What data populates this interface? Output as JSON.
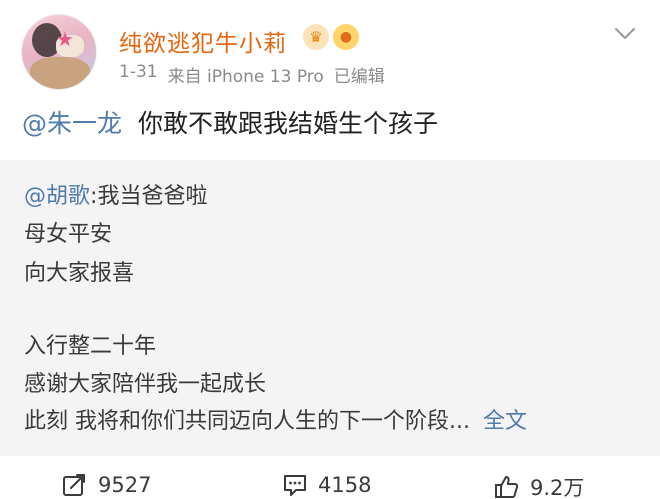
{
  "post": {
    "username": "纯欲逃犯牛小莉",
    "date": "1-31",
    "source": "来自 iPhone 13 Pro",
    "edited": "已编辑",
    "mention": "@朱一龙",
    "text": "你敢不敢跟我结婚生个孩子"
  },
  "repost": {
    "mention": "@胡歌",
    "lines": [
      "我当爸爸啦",
      "母女平安",
      "向大家报喜",
      "",
      "入行整二十年",
      "感谢大家陪伴我一起成长",
      "此刻 我将和你们共同迈向人生的下一个阶段..."
    ],
    "separator": ":",
    "full_text_link": "全文"
  },
  "actions": {
    "repost_count": "9527",
    "comment_count": "4158",
    "like_count": "9.2万"
  },
  "colors": {
    "username": "#e8650f",
    "link": "#4f7cad",
    "quote_bg": "#f4f4f4",
    "meta": "#8a8a8a"
  },
  "icons": [
    "avatar",
    "crown-badge-icon",
    "fish-badge-icon",
    "chevron-down-icon",
    "repost-icon",
    "comment-icon",
    "like-icon"
  ]
}
